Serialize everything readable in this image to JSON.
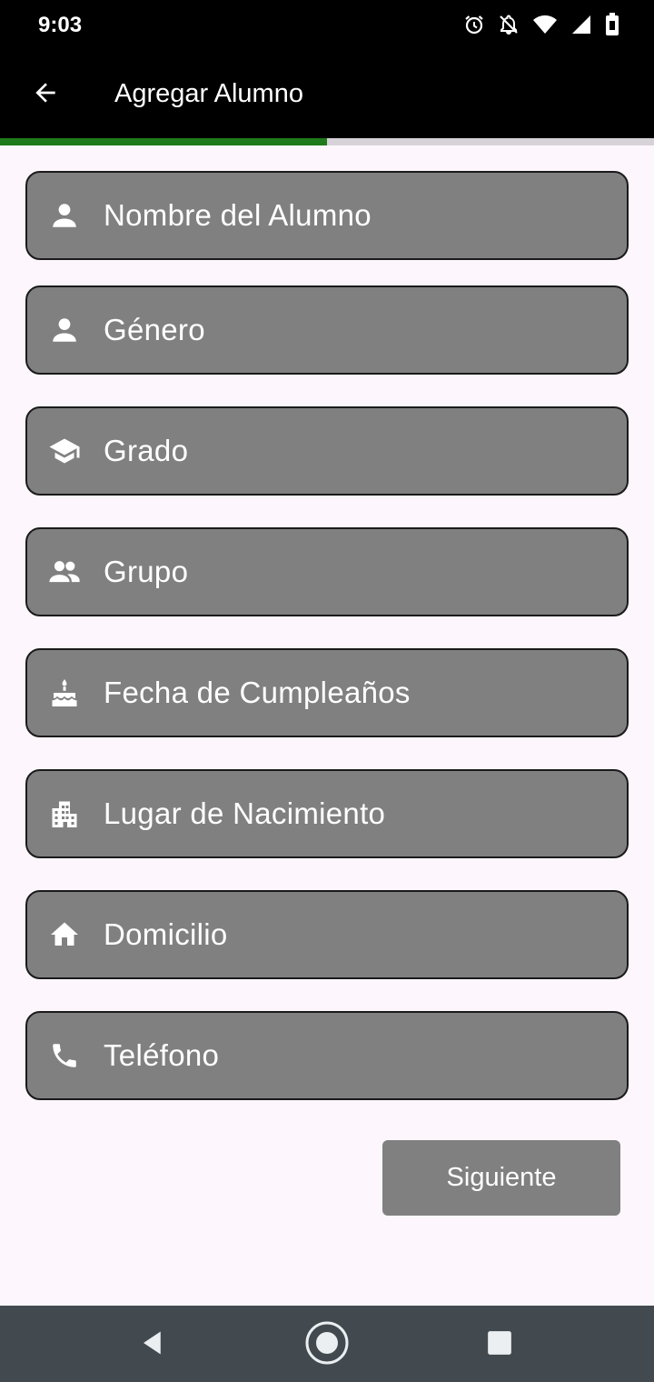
{
  "status_bar": {
    "time": "9:03",
    "icons": [
      "alarm-icon",
      "notifications-off-icon",
      "wifi-icon",
      "signal-icon",
      "battery-icon"
    ]
  },
  "app_bar": {
    "title": "Agregar Alumno",
    "back_icon": "arrow-back-icon"
  },
  "progress": {
    "value": 0.5,
    "fill_color": "#1f7a1a"
  },
  "form": {
    "fields": [
      {
        "label": "Nombre del Alumno",
        "icon": "person-icon"
      },
      {
        "label": "Género",
        "icon": "person-icon"
      },
      {
        "label": "Grado",
        "icon": "school-icon"
      },
      {
        "label": "Grupo",
        "icon": "group-icon"
      },
      {
        "label": "Fecha de Cumpleaños",
        "icon": "cake-icon"
      },
      {
        "label": "Lugar de Nacimiento",
        "icon": "city-icon"
      },
      {
        "label": "Domicilio",
        "icon": "home-icon"
      },
      {
        "label": "Teléfono",
        "icon": "phone-icon"
      }
    ],
    "submit_label": "Siguiente"
  },
  "nav_bar": {
    "items": [
      "back-icon",
      "home-icon",
      "recents-icon"
    ]
  }
}
